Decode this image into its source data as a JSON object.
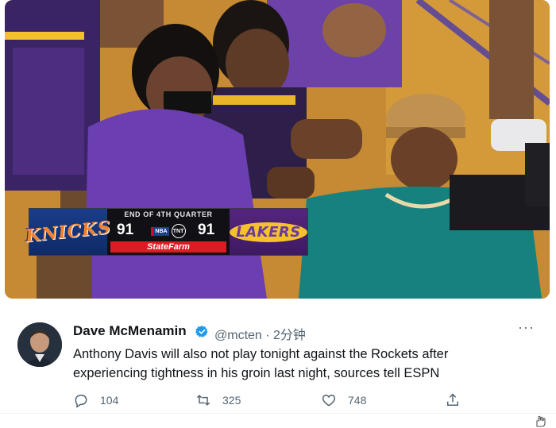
{
  "scoreboard": {
    "period": "END OF 4TH QUARTER",
    "home_team": "KNICKS",
    "home_score": "91",
    "away_score": "91",
    "away_team": "LAKERS",
    "network_nba": "NBA",
    "network_tnt": "TNT",
    "sponsor": "StateFarm"
  },
  "tweet": {
    "author_name": "Dave McMenamin",
    "handle_time": "@mcten · 2分钟",
    "text": "Anthony Davis will also not play tonight against the Rockets after experiencing tightness in his groin last night, sources tell ESPN",
    "more_label": "···",
    "reply_count": "104",
    "retweet_count": "325",
    "like_count": "748"
  },
  "colors": {
    "accent": "#1d9bf0",
    "lakers_purple": "#55257f",
    "lakers_gold": "#f6c22b",
    "knicks_blue": "#1b3d8a",
    "knicks_orange": "#f0822e",
    "sponsor_red": "#e01a22"
  },
  "icons": [
    "verified-badge-icon",
    "more-options-icon",
    "reply-icon",
    "retweet-icon",
    "like-icon",
    "share-icon",
    "hand-icon"
  ]
}
